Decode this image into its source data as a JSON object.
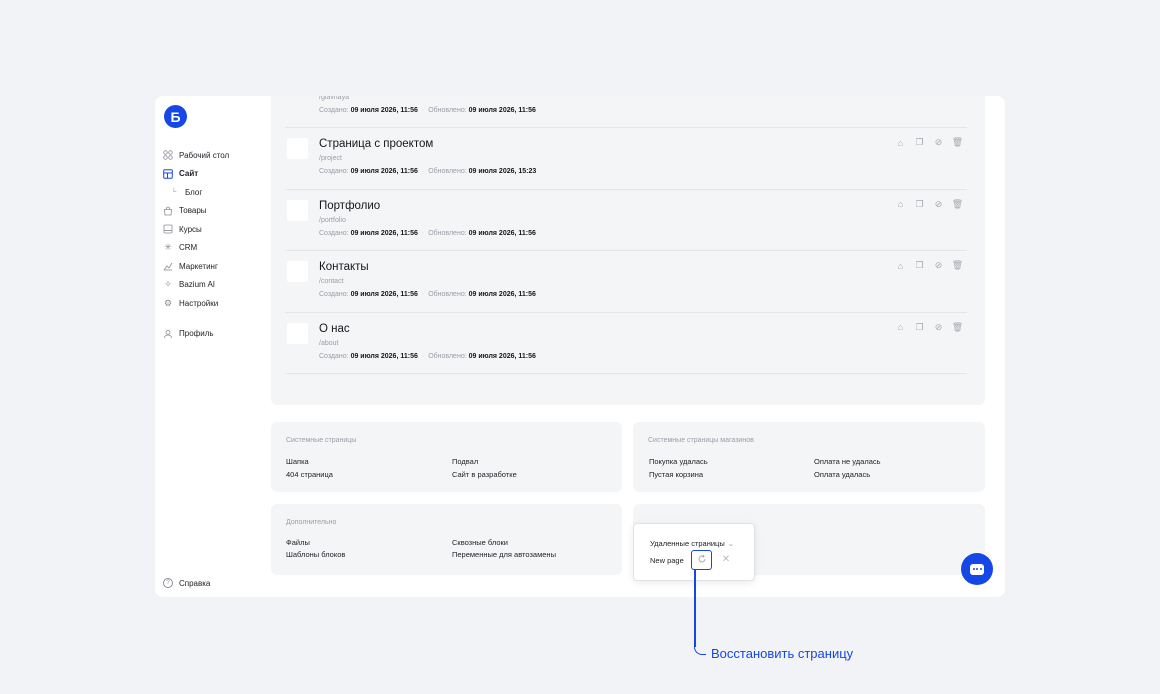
{
  "app": {
    "logo_letter": "Б",
    "accent": "#1547e6"
  },
  "sidebar": {
    "items": [
      {
        "label": "Рабочий стол",
        "icon": "dashboard-icon"
      },
      {
        "label": "Сайт",
        "icon": "site-icon",
        "active": true
      },
      {
        "label": "Блог",
        "icon": "sub-arrow-icon"
      },
      {
        "label": "Товары",
        "icon": "bag-icon"
      },
      {
        "label": "Курсы",
        "icon": "courses-icon"
      },
      {
        "label": "CRM",
        "icon": "crm-icon"
      },
      {
        "label": "Маркетинг",
        "icon": "marketing-icon"
      },
      {
        "label": "Bazium AI",
        "icon": "ai-icon"
      },
      {
        "label": "Настройки",
        "icon": "gear-icon"
      }
    ],
    "profile": {
      "label": "Профиль",
      "icon": "user-icon"
    },
    "help": {
      "label": "Справка",
      "icon": "question-icon"
    }
  },
  "pages": {
    "created_label": "Создано:",
    "updated_label": "Обновлено:",
    "rows": [
      {
        "title": "",
        "slug": "/glavnaya",
        "created": "09 июля 2026, 11:56",
        "updated": "09 июля 2026, 11:56"
      },
      {
        "title": "Страница с проектом",
        "slug": "/project",
        "created": "09 июля 2026, 11:56",
        "updated": "09 июля 2026, 15:23"
      },
      {
        "title": "Портфолио",
        "slug": "/portfolio",
        "created": "09 июля 2026, 11:56",
        "updated": "09 июля 2026, 11:56"
      },
      {
        "title": "Контакты",
        "slug": "/contact",
        "created": "09 июля 2026, 11:56",
        "updated": "09 июля 2026, 11:56"
      },
      {
        "title": "О нас",
        "slug": "/about",
        "created": "09 июля 2026, 11:56",
        "updated": "09 июля 2026, 11:56"
      }
    ],
    "row_actions": [
      "home-icon",
      "copy-icon",
      "link-icon",
      "trash-icon"
    ]
  },
  "system_pages": {
    "title": "Системные страницы",
    "items": [
      "Шапка",
      "Подвал",
      "404 страница",
      "Сайт в разработке"
    ]
  },
  "shop_pages": {
    "title": "Системные страницы магазинов",
    "items": [
      "Покупка удалась",
      "Оплата не удалась",
      "Пустая корзина",
      "Оплата удалась"
    ]
  },
  "extra": {
    "title": "Дополнительно",
    "items": [
      "Файлы",
      "Сквозные блоки",
      "Шаблоны блоков",
      "Переменные для автозамены"
    ]
  },
  "deleted_popup": {
    "title": "Удаленные страницы",
    "item": "New page"
  },
  "callout": {
    "label": "Восстановить страницу"
  }
}
